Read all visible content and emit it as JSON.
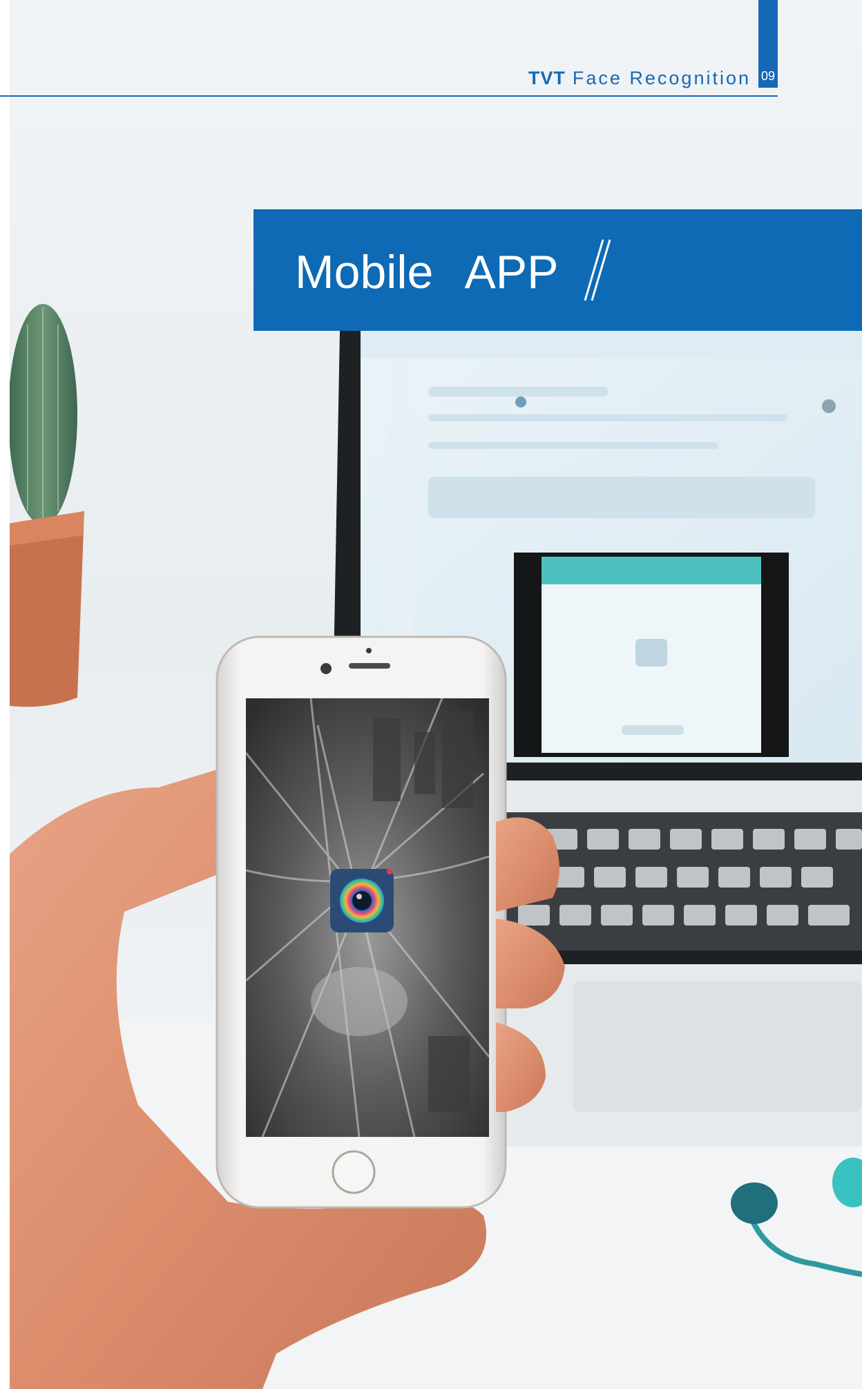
{
  "header": {
    "brand": "TVT",
    "title": "Face Recognition",
    "page_number": "09"
  },
  "section": {
    "title": "Mobile  APP"
  },
  "colors": {
    "accent_blue": "#1668b6",
    "banner_blue": "#0e6ab4"
  },
  "icons": {
    "slash": "double-slash-icon",
    "app": "camera-lens-app-icon"
  }
}
